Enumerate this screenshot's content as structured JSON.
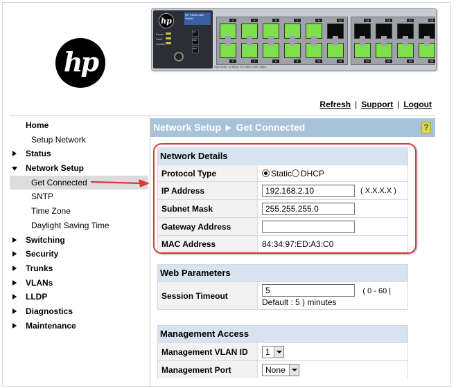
{
  "logo": {
    "text": "hp"
  },
  "switch_panel": {
    "brand": "hp",
    "model_label": "HP V1810-48G Switch",
    "led_labels": [
      "Power",
      "Fault",
      "Locator"
    ],
    "button_labels": [
      "Act",
      "FDx",
      "Spd"
    ],
    "reset_label": "Reset",
    "legend_text": "Spd Mode: 10 Mbps  100 Mbps  1000 Mbps",
    "top_port_numbers": [
      "1",
      "3",
      "5",
      "7",
      "9",
      "11",
      "13",
      "15",
      "17",
      "19"
    ],
    "bottom_port_numbers": [
      "2",
      "4",
      "6",
      "8",
      "10",
      "12",
      "14",
      "16",
      "18",
      "20"
    ]
  },
  "top_links": {
    "refresh": "Refresh",
    "support": "Support",
    "logout": "Logout",
    "separator": "|"
  },
  "sidebar": {
    "items": [
      {
        "label": "Home",
        "level": "top",
        "arrow": "none"
      },
      {
        "label": "Setup Network",
        "level": "sub"
      },
      {
        "label": "Status",
        "level": "top",
        "arrow": "right"
      },
      {
        "label": "Network Setup",
        "level": "top",
        "arrow": "down"
      },
      {
        "label": "Get Connected",
        "level": "sub",
        "selected": true
      },
      {
        "label": "SNTP",
        "level": "sub"
      },
      {
        "label": "Time Zone",
        "level": "sub"
      },
      {
        "label": "Daylight Saving Time",
        "level": "sub"
      },
      {
        "label": "Switching",
        "level": "top",
        "arrow": "right"
      },
      {
        "label": "Security",
        "level": "top",
        "arrow": "right"
      },
      {
        "label": "Trunks",
        "level": "top",
        "arrow": "right"
      },
      {
        "label": "VLANs",
        "level": "top",
        "arrow": "right"
      },
      {
        "label": "LLDP",
        "level": "top",
        "arrow": "right"
      },
      {
        "label": "Diagnostics",
        "level": "top",
        "arrow": "right"
      },
      {
        "label": "Maintenance",
        "level": "top",
        "arrow": "right"
      }
    ]
  },
  "page": {
    "title": "Network Setup ► Get Connected",
    "help": "?"
  },
  "network_details": {
    "heading": "Network Details",
    "protocol_type": {
      "label": "Protocol Type",
      "option_static": "Static",
      "option_dhcp": "DHCP",
      "selected": "Static"
    },
    "ip_address": {
      "label": "IP Address",
      "value": "192.168.2.10",
      "hint": "( X.X.X.X )"
    },
    "subnet_mask": {
      "label": "Subnet Mask",
      "value": "255.255.255.0"
    },
    "gateway_address": {
      "label": "Gateway Address",
      "value": ""
    },
    "mac_address": {
      "label": "MAC Address",
      "value": "84:34:97:ED:A3:C0"
    }
  },
  "web_parameters": {
    "heading": "Web Parameters",
    "session_timeout": {
      "label": "Session Timeout",
      "value": "5",
      "range": "( 0 - 60 |",
      "default_text": "Default : 5 ) minutes"
    }
  },
  "management_access": {
    "heading": "Management Access",
    "vlan_id": {
      "label": "Management VLAN ID",
      "value": "1"
    },
    "port": {
      "label": "Management Port",
      "value": "None"
    }
  },
  "colors": {
    "title_bar": "#a8c3d9",
    "section_header": "#d7e4ef",
    "callout": "#d93a3a",
    "port_green": "#7ee04b"
  }
}
